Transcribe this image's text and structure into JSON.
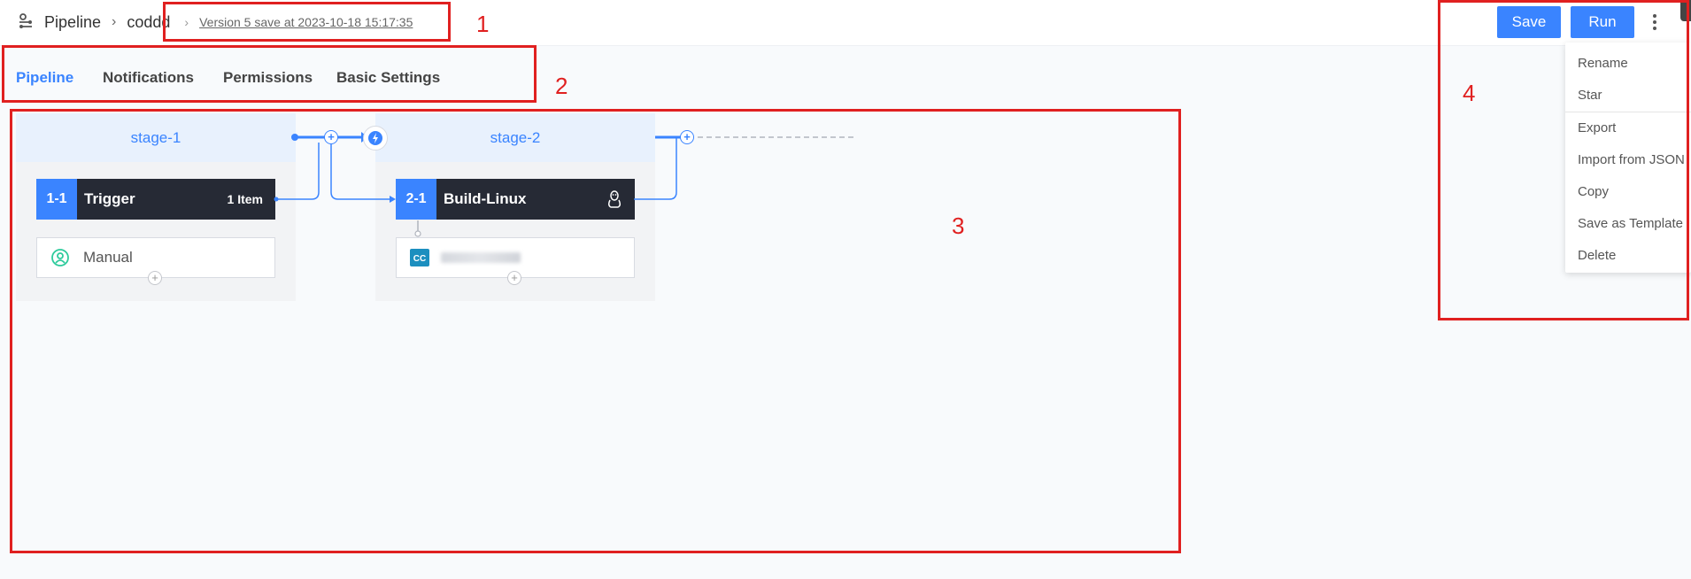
{
  "header": {
    "breadcrumb_root": "Pipeline",
    "breadcrumb_project": "coddd",
    "version_text": "Version 5 save at 2023-10-18 15:17:35",
    "save_label": "Save",
    "run_label": "Run"
  },
  "menu": {
    "items": [
      "Rename",
      "Star",
      "Export",
      "Import from JSON",
      "Copy",
      "Save as Template",
      "Delete"
    ]
  },
  "tabs": [
    {
      "label": "Pipeline",
      "active": true
    },
    {
      "label": "Notifications",
      "active": false
    },
    {
      "label": "Permissions",
      "active": false
    },
    {
      "label": "Basic Settings",
      "active": false
    }
  ],
  "stages": [
    {
      "name": "stage-1",
      "job": {
        "number": "1-1",
        "name": "Trigger",
        "extra": "1 Item"
      },
      "atom": {
        "label": "Manual",
        "icon": "manual-trigger-icon"
      }
    },
    {
      "name": "stage-2",
      "job": {
        "number": "2-1",
        "name": "Build-Linux",
        "extra": "linux-icon"
      },
      "atom": {
        "label": "",
        "icon": "codecc-icon"
      }
    }
  ],
  "annotations": [
    "1",
    "2",
    "3",
    "4"
  ],
  "colors": {
    "accent": "#3a84ff",
    "annotation": "#e02020",
    "job_bg": "#262a35",
    "stage_head_bg": "#e8f1fd"
  }
}
